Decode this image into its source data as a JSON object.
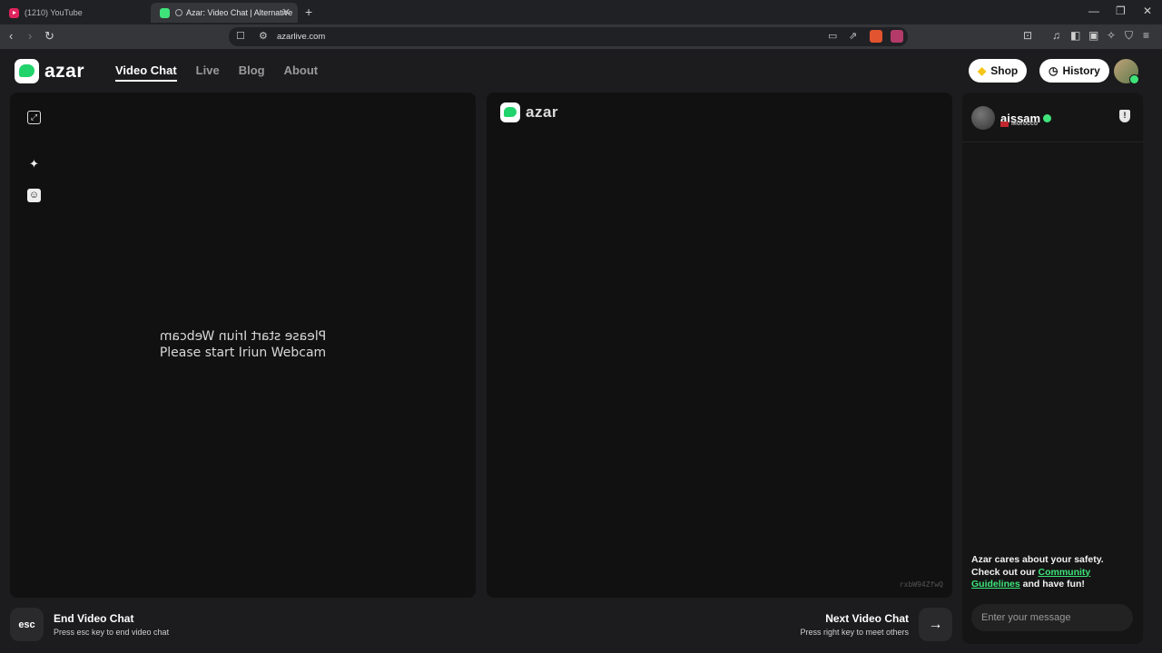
{
  "browser": {
    "tabs": [
      {
        "title": "(1210) YouTube"
      },
      {
        "title": "Azar: Video Chat | Alternative"
      }
    ],
    "url": "azarlive.com"
  },
  "header": {
    "logo": "azar",
    "nav": [
      "Video Chat",
      "Live",
      "Blog",
      "About"
    ],
    "shop_label": "Shop",
    "history_label": "History"
  },
  "left_panel": {
    "webcam_message": "Please start Iriun Webcam"
  },
  "right_panel": {
    "logo": "azar",
    "session_id": "rxbW94ZfwQ"
  },
  "chat": {
    "peer_name": "aissam",
    "peer_country": "Morocco",
    "safety_text_1": "Azar cares about your safety. Check out our ",
    "safety_link": "Community Guidelines",
    "safety_text_2": " and have fun!",
    "input_placeholder": "Enter your message"
  },
  "footer": {
    "end_key": "esc",
    "end_title": "End Video Chat",
    "end_sub": "Press esc key to end video chat",
    "next_title": "Next Video Chat",
    "next_sub": "Press right key to meet others"
  },
  "colors": {
    "accent": "#3ee47a",
    "panel_bg": "#111111"
  }
}
